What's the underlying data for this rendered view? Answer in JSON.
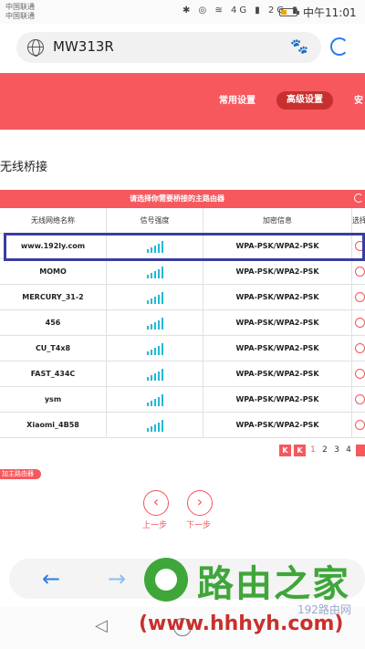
{
  "status_bar": {
    "carrier1": "中国联通",
    "carrier2": "中国联通",
    "icons": "✱ ◎ ≋ 4G ▮ 2G ▮",
    "time": "中午11:01",
    "battery_level": 0.35
  },
  "browser": {
    "url": "MW313R"
  },
  "router_nav": {
    "items": [
      "常用设置",
      "高级设置",
      "安"
    ]
  },
  "section_title": "无线桥接",
  "table": {
    "banner": "请选择你需要桥接的主路由器",
    "headers": [
      "无线网络名称",
      "信号强度",
      "加密信息",
      "选择"
    ],
    "rows": [
      {
        "name": "www.192ly.com",
        "encryption": "WPA-PSK/WPA2-PSK"
      },
      {
        "name": "MOMO",
        "encryption": "WPA-PSK/WPA2-PSK"
      },
      {
        "name": "MERCURY_31-2",
        "encryption": "WPA-PSK/WPA2-PSK"
      },
      {
        "name": "456",
        "encryption": "WPA-PSK/WPA2-PSK"
      },
      {
        "name": "CU_T4x8",
        "encryption": "WPA-PSK/WPA2-PSK"
      },
      {
        "name": "FAST_434C",
        "encryption": "WPA-PSK/WPA2-PSK"
      },
      {
        "name": "ysm",
        "encryption": "WPA-PSK/WPA2-PSK"
      },
      {
        "name": "Xiaomi_4B58",
        "encryption": "WPA-PSK/WPA2-PSK"
      }
    ]
  },
  "pagination": {
    "first": "K",
    "prev": "K",
    "pages": [
      "1",
      "2",
      "3",
      "4"
    ]
  },
  "add_router": "加主路由器",
  "steps": {
    "prev": "上一步",
    "next": "下一步"
  },
  "watermark": {
    "brand": "路由之家",
    "url": "(www.hhhyh.com)",
    "small": "192路由网"
  },
  "colors": {
    "accent": "#f6585e",
    "highlight": "#3a3da0",
    "signal": "#22b8d6"
  }
}
